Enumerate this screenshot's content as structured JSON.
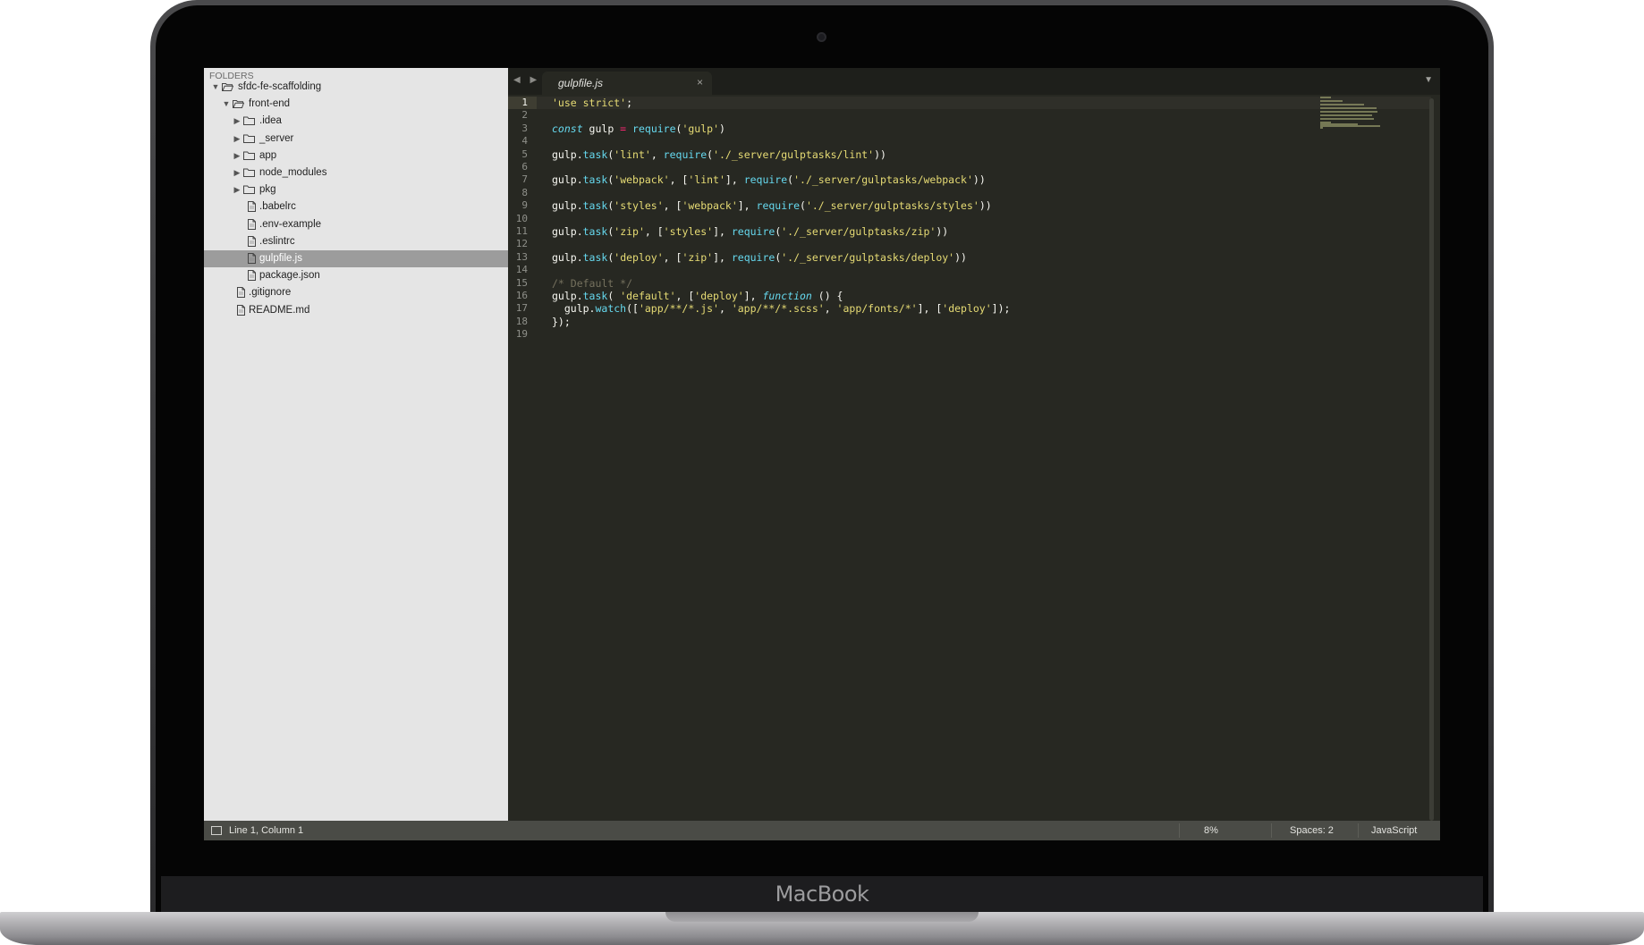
{
  "brand": "MacBook",
  "sidebar": {
    "header": "FOLDERS",
    "items": [
      {
        "label": "sfdc-fe-scaffolding",
        "type": "folder",
        "open": true
      },
      {
        "label": "front-end",
        "type": "folder",
        "open": true
      },
      {
        "label": ".idea",
        "type": "folder",
        "open": false
      },
      {
        "label": "_server",
        "type": "folder",
        "open": false
      },
      {
        "label": "app",
        "type": "folder",
        "open": false
      },
      {
        "label": "node_modules",
        "type": "folder",
        "open": false
      },
      {
        "label": "pkg",
        "type": "folder",
        "open": false
      },
      {
        "label": ".babelrc",
        "type": "file"
      },
      {
        "label": ".env-example",
        "type": "file"
      },
      {
        "label": ".eslintrc",
        "type": "file"
      },
      {
        "label": "gulpfile.js",
        "type": "file",
        "selected": true
      },
      {
        "label": "package.json",
        "type": "file"
      },
      {
        "label": ".gitignore",
        "type": "file"
      },
      {
        "label": "README.md",
        "type": "file"
      }
    ]
  },
  "editor": {
    "tab_title": "gulpfile.js",
    "tab_close": "×",
    "nav_arrows": "◀ ▶",
    "tab_menu": "▼",
    "line_numbers": [
      "1",
      "2",
      "3",
      "4",
      "5",
      "6",
      "7",
      "8",
      "9",
      "10",
      "11",
      "12",
      "13",
      "14",
      "15",
      "16",
      "17",
      "18",
      "19"
    ],
    "code_lines": [
      "'use strict';",
      "",
      "const gulp = require('gulp')",
      "",
      "gulp.task('lint', require('./_server/gulptasks/lint'))",
      "",
      "gulp.task('webpack', ['lint'], require('./_server/gulptasks/webpack'))",
      "",
      "gulp.task('styles', ['webpack'], require('./_server/gulptasks/styles'))",
      "",
      "gulp.task('zip', ['styles'], require('./_server/gulptasks/zip'))",
      "",
      "gulp.task('deploy', ['zip'], require('./_server/gulptasks/deploy'))",
      "",
      "/* Default */",
      "gulp.task( 'default', ['deploy'], function () {",
      "  gulp.watch(['app/**/*.js', 'app/**/*.scss', 'app/fonts/*'], ['deploy']);",
      "});",
      ""
    ],
    "syntax_colors": {
      "background": "#272822",
      "string": "#e6db74",
      "keyword": "#f92672",
      "function": "#66d9ef",
      "comment": "#75715e"
    }
  },
  "statusbar": {
    "position": "Line 1, Column 1",
    "percent": "8%",
    "indentation": "Spaces: 2",
    "syntax": "JavaScript"
  }
}
